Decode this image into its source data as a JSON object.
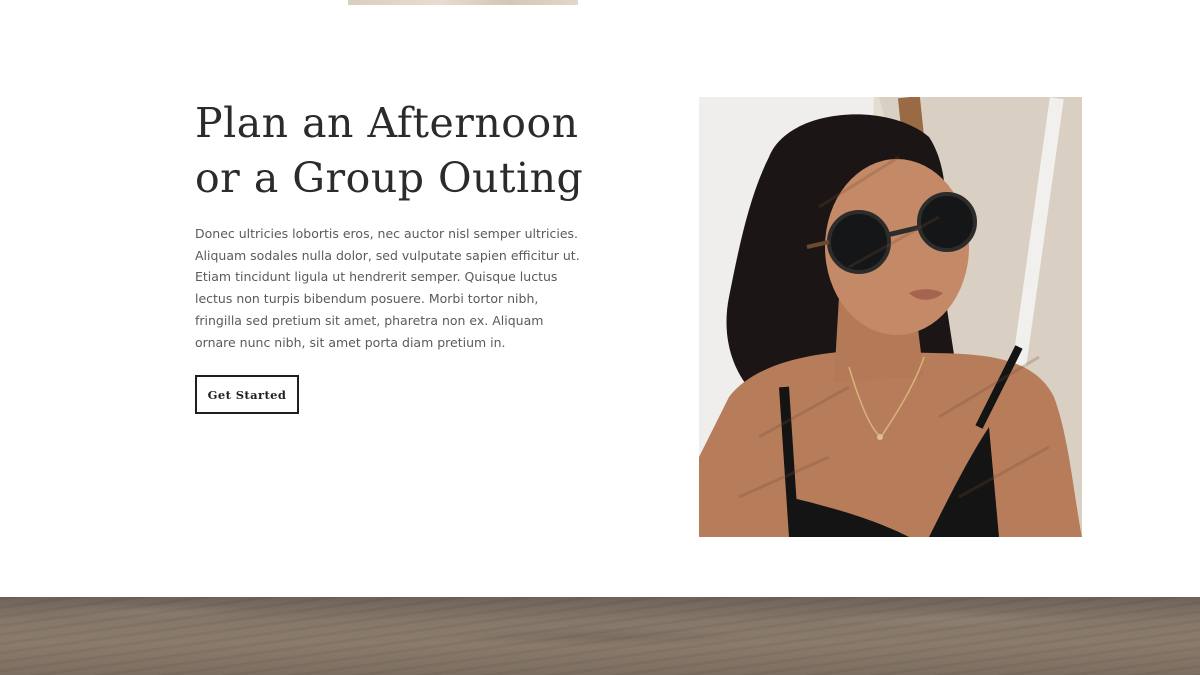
{
  "section": {
    "heading_line1": "Plan an Afternoon",
    "heading_line2": "or a Group Outing",
    "body": "Donec ultricies lobortis eros, nec auctor nisl semper ultricies. Aliquam sodales nulla dolor, sed vulputate sapien efficitur ut. Etiam tincidunt ligula ut hendrerit semper. Quisque luctus lectus non turpis bibendum posuere. Morbi tortor nibh, fringilla sed pretium sit amet, pharetra non ex. Aliquam ornare nunc nibh, sit amet porta diam pretium in.",
    "cta_label": "Get Started"
  },
  "colors": {
    "heading": "#2b2b2b",
    "body_text": "#5a5a5a",
    "button_border": "#1f1f1f",
    "background": "#ffffff"
  }
}
